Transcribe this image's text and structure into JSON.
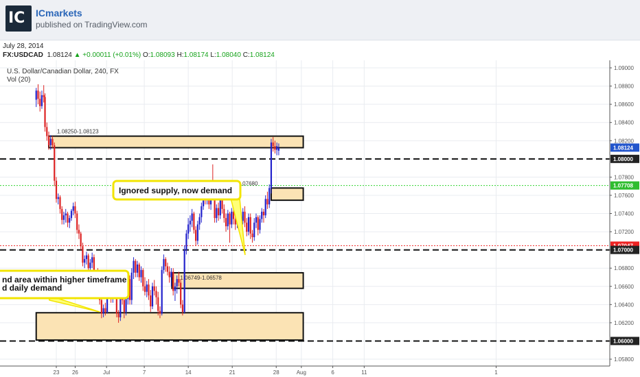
{
  "header": {
    "publisher": "ICmarkets",
    "subtitle": "published on TradingView.com",
    "logo_letters": "IC"
  },
  "date": "July 28, 2014",
  "quote": {
    "symbol": "FX:USDCAD",
    "last": "1.08124",
    "change": "+0.00011 (+0.01%)",
    "o_label": "O:",
    "o": "1.08093",
    "h_label": "H:",
    "h": "1.08174",
    "l_label": "L:",
    "l": "1.08040",
    "c_label": "C:",
    "c": "1.08124"
  },
  "chart_data": {
    "type": "candlestick",
    "title": "U.S. Dollar/Canadian Dollar, 240, FX",
    "indicator": "Vol (20)",
    "ylim": [
      1.0575,
      1.091
    ],
    "y_ticks": [
      "1.09000",
      "1.08800",
      "1.08600",
      "1.08400",
      "1.08200",
      "1.08000",
      "1.07800",
      "1.07600",
      "1.07400",
      "1.07200",
      "1.07000",
      "1.06800",
      "1.06600",
      "1.06400",
      "1.06200",
      "1.06000",
      "1.05800"
    ],
    "x_ticks": [
      {
        "label": "23",
        "day": 0
      },
      {
        "label": "26",
        "day": 3
      },
      {
        "label": "Jul",
        "day": 8
      },
      {
        "label": "7",
        "day": 14
      },
      {
        "label": "14",
        "day": 21
      },
      {
        "label": "21",
        "day": 28
      },
      {
        "label": "28",
        "day": 35
      },
      {
        "label": "Aug",
        "day": 39
      },
      {
        "label": "6",
        "day": 44
      },
      {
        "label": "11",
        "day": 49
      },
      {
        "label": "1",
        "day": 70
      }
    ],
    "colors": {
      "up": "#2222cc",
      "down": "#dd2222",
      "zone_fill": "#fbe3b4",
      "green_line": "#2fd22f",
      "red_line": "#ee2222"
    },
    "price_labels": [
      {
        "text": "1.08124",
        "price": 1.08124,
        "color": "#2255cc"
      },
      {
        "text": "1.08000",
        "price": 1.08,
        "color": "#222222"
      },
      {
        "text": "1.07708",
        "price": 1.07708,
        "color": "#2fbd2f"
      },
      {
        "text": "1.07047",
        "price": 1.07047,
        "color": "#ee2222"
      },
      {
        "text": "1.07000",
        "price": 1.07,
        "color": "#222222"
      },
      {
        "text": "1.06000",
        "price": 1.06,
        "color": "#222222"
      }
    ],
    "dashed_levels": [
      {
        "price": 1.08,
        "color": "#111111"
      },
      {
        "price": 1.07,
        "color": "#111111"
      },
      {
        "price": 1.06,
        "color": "#111111"
      }
    ],
    "dotted_levels": [
      {
        "price": 1.07708,
        "color": "#2fd22f"
      },
      {
        "price": 1.07047,
        "color": "#ee2222"
      }
    ],
    "zones": [
      {
        "label": "1.08250-1.08123",
        "top": 1.0825,
        "bottom": 1.08123,
        "d0": -1.2,
        "d1": 39.3
      },
      {
        "label": "1.07546-1.07680",
        "top": 1.0768,
        "bottom": 1.07546,
        "d0": 34.2,
        "d1": 39.3
      },
      {
        "label": "1.06749-1.06578",
        "top": 1.06749,
        "bottom": 1.06578,
        "d0": 18.4,
        "d1": 39.3
      },
      {
        "label": "",
        "top": 1.0631,
        "bottom": 1.0601,
        "d0": -3.2,
        "d1": 39.3
      }
    ],
    "annotations": [
      {
        "text": "Ignored supply, now demand"
      },
      {
        "text": "nd area within higher timeframe"
      },
      {
        "text": "d daily demand"
      }
    ],
    "candles": [
      [
        -3.2,
        1.0865,
        1.0878,
        1.0857,
        1.0875
      ],
      [
        -2.9,
        1.0875,
        1.0882,
        1.086,
        1.0866
      ],
      [
        -2.6,
        1.0866,
        1.0874,
        1.0852,
        1.0858
      ],
      [
        -2.3,
        1.0858,
        1.0875,
        1.0855,
        1.087
      ],
      [
        -2.0,
        1.087,
        1.0881,
        1.0862,
        1.0868
      ],
      [
        -1.8,
        1.0868,
        1.0872,
        1.083,
        1.0835
      ],
      [
        -1.5,
        1.0835,
        1.084,
        1.082,
        1.0825
      ],
      [
        -1.2,
        1.0825,
        1.083,
        1.081,
        1.0815
      ],
      [
        -0.9,
        1.0815,
        1.0826,
        1.081,
        1.0822
      ],
      [
        -0.6,
        1.0822,
        1.0825,
        1.0812,
        1.0815
      ],
      [
        -0.3,
        1.0815,
        1.0818,
        1.077,
        1.0776
      ],
      [
        0.0,
        1.0776,
        1.078,
        1.0752,
        1.0756
      ],
      [
        0.3,
        1.0756,
        1.0762,
        1.075,
        1.0758
      ],
      [
        0.6,
        1.0758,
        1.076,
        1.074,
        1.0745
      ],
      [
        0.9,
        1.0745,
        1.0748,
        1.0728,
        1.0733
      ],
      [
        1.2,
        1.0733,
        1.0742,
        1.0728,
        1.0738
      ],
      [
        1.5,
        1.0738,
        1.0745,
        1.073,
        1.074
      ],
      [
        1.8,
        1.074,
        1.0742,
        1.0725,
        1.073
      ],
      [
        2.1,
        1.073,
        1.0738,
        1.0724,
        1.0735
      ],
      [
        2.4,
        1.0735,
        1.0745,
        1.0732,
        1.0743
      ],
      [
        2.7,
        1.0743,
        1.0752,
        1.0738,
        1.0748
      ],
      [
        3.0,
        1.0748,
        1.0753,
        1.0735,
        1.074
      ],
      [
        3.3,
        1.074,
        1.0743,
        1.0718,
        1.0722
      ],
      [
        3.6,
        1.0722,
        1.0728,
        1.0712,
        1.0718
      ],
      [
        3.9,
        1.0718,
        1.072,
        1.07,
        1.0704
      ],
      [
        4.2,
        1.0704,
        1.0708,
        1.0682,
        1.0686
      ],
      [
        4.5,
        1.0686,
        1.0694,
        1.068,
        1.069
      ],
      [
        4.8,
        1.069,
        1.0698,
        1.0684,
        1.0694
      ],
      [
        5.1,
        1.0694,
        1.0696,
        1.0676,
        1.068
      ],
      [
        5.4,
        1.068,
        1.069,
        1.0675,
        1.0686
      ],
      [
        5.7,
        1.0686,
        1.0697,
        1.068,
        1.0692
      ],
      [
        6.0,
        1.0692,
        1.0695,
        1.0665,
        1.0668
      ],
      [
        6.3,
        1.0668,
        1.0678,
        1.066,
        1.0674
      ],
      [
        6.6,
        1.0674,
        1.068,
        1.0662,
        1.0666
      ],
      [
        6.9,
        1.0666,
        1.0672,
        1.064,
        1.0645
      ],
      [
        7.2,
        1.0645,
        1.0652,
        1.0625,
        1.063
      ],
      [
        7.5,
        1.063,
        1.064,
        1.0626,
        1.0636
      ],
      [
        7.8,
        1.0636,
        1.0642,
        1.0628,
        1.0632
      ],
      [
        8.1,
        1.0632,
        1.066,
        1.063,
        1.0656
      ],
      [
        8.4,
        1.0656,
        1.0668,
        1.065,
        1.0662
      ],
      [
        8.7,
        1.0662,
        1.0666,
        1.0642,
        1.0646
      ],
      [
        9.0,
        1.0646,
        1.0676,
        1.0642,
        1.0672
      ],
      [
        9.3,
        1.0672,
        1.0678,
        1.065,
        1.0655
      ],
      [
        9.6,
        1.0655,
        1.066,
        1.0626,
        1.063
      ],
      [
        9.9,
        1.063,
        1.0634,
        1.062,
        1.0626
      ],
      [
        10.2,
        1.0626,
        1.0652,
        1.0622,
        1.0648
      ],
      [
        10.5,
        1.0648,
        1.066,
        1.064,
        1.0645
      ],
      [
        10.8,
        1.0645,
        1.065,
        1.0625,
        1.0632
      ],
      [
        11.1,
        1.0632,
        1.065,
        1.0628,
        1.0646
      ],
      [
        11.4,
        1.0646,
        1.0672,
        1.064,
        1.0668
      ],
      [
        11.7,
        1.0668,
        1.0672,
        1.064,
        1.0645
      ],
      [
        12.0,
        1.0645,
        1.068,
        1.064,
        1.0675
      ],
      [
        12.3,
        1.0675,
        1.0692,
        1.0668,
        1.0688
      ],
      [
        12.6,
        1.0688,
        1.069,
        1.067,
        1.0675
      ],
      [
        12.9,
        1.0675,
        1.0688,
        1.067,
        1.0684
      ],
      [
        13.2,
        1.0684,
        1.0686,
        1.0666,
        1.067
      ],
      [
        13.5,
        1.067,
        1.0682,
        1.0664,
        1.0678
      ],
      [
        13.8,
        1.0678,
        1.068,
        1.0655,
        1.066
      ],
      [
        14.1,
        1.066,
        1.067,
        1.065,
        1.0654
      ],
      [
        14.4,
        1.0654,
        1.0666,
        1.0648,
        1.0662
      ],
      [
        14.7,
        1.0662,
        1.0668,
        1.0645,
        1.065
      ],
      [
        15.0,
        1.065,
        1.0656,
        1.0632,
        1.0638
      ],
      [
        15.3,
        1.0638,
        1.0664,
        1.0635,
        1.066
      ],
      [
        15.6,
        1.066,
        1.0667,
        1.065,
        1.0655
      ],
      [
        15.9,
        1.0655,
        1.066,
        1.064,
        1.0648
      ],
      [
        16.2,
        1.0648,
        1.0654,
        1.0628,
        1.0633
      ],
      [
        16.5,
        1.0633,
        1.0638,
        1.0625,
        1.063
      ],
      [
        16.8,
        1.063,
        1.0682,
        1.0628,
        1.0678
      ],
      [
        17.1,
        1.0678,
        1.0695,
        1.0674,
        1.069
      ],
      [
        17.4,
        1.069,
        1.0692,
        1.0676,
        1.0682
      ],
      [
        17.7,
        1.0682,
        1.0686,
        1.0672,
        1.0676
      ],
      [
        18.0,
        1.0676,
        1.0682,
        1.0664,
        1.067
      ],
      [
        18.3,
        1.067,
        1.068,
        1.066,
        1.0676
      ],
      [
        18.6,
        1.0676,
        1.068,
        1.065,
        1.0655
      ],
      [
        18.9,
        1.0655,
        1.0664,
        1.0644,
        1.066
      ],
      [
        19.2,
        1.066,
        1.0672,
        1.0652,
        1.0668
      ],
      [
        19.5,
        1.0668,
        1.0676,
        1.066,
        1.0664
      ],
      [
        19.8,
        1.0664,
        1.0668,
        1.0636,
        1.064
      ],
      [
        20.1,
        1.064,
        1.0645,
        1.0628,
        1.0632
      ],
      [
        20.4,
        1.0632,
        1.0705,
        1.063,
        1.07
      ],
      [
        20.7,
        1.07,
        1.0722,
        1.0695,
        1.0718
      ],
      [
        21.0,
        1.0718,
        1.0735,
        1.0712,
        1.0728
      ],
      [
        21.3,
        1.0728,
        1.0738,
        1.072,
        1.0732
      ],
      [
        21.6,
        1.0732,
        1.0745,
        1.0725,
        1.074
      ],
      [
        21.9,
        1.074,
        1.0742,
        1.0718,
        1.0722
      ],
      [
        22.2,
        1.0722,
        1.0726,
        1.0705,
        1.071
      ],
      [
        22.5,
        1.071,
        1.0732,
        1.0706,
        1.0728
      ],
      [
        22.8,
        1.0728,
        1.074,
        1.0722,
        1.0736
      ],
      [
        23.1,
        1.0736,
        1.0752,
        1.073,
        1.0748
      ],
      [
        23.4,
        1.0748,
        1.0768,
        1.0744,
        1.0762
      ],
      [
        23.7,
        1.0762,
        1.0772,
        1.075,
        1.0755
      ],
      [
        24.0,
        1.0755,
        1.0776,
        1.075,
        1.077
      ],
      [
        24.3,
        1.077,
        1.0772,
        1.0745,
        1.075
      ],
      [
        24.6,
        1.075,
        1.0766,
        1.0744,
        1.0762
      ],
      [
        24.9,
        1.0762,
        1.0794,
        1.0755,
        1.0758
      ],
      [
        25.2,
        1.0758,
        1.0762,
        1.073,
        1.0735
      ],
      [
        25.5,
        1.0735,
        1.075,
        1.073,
        1.0746
      ],
      [
        25.8,
        1.0746,
        1.0752,
        1.0732,
        1.0738
      ],
      [
        26.1,
        1.0738,
        1.0764,
        1.0734,
        1.076
      ],
      [
        26.4,
        1.076,
        1.0764,
        1.074,
        1.0745
      ],
      [
        26.7,
        1.0745,
        1.075,
        1.073,
        1.0735
      ],
      [
        27.0,
        1.0735,
        1.074,
        1.072,
        1.0726
      ],
      [
        27.3,
        1.0726,
        1.0744,
        1.0722,
        1.074
      ],
      [
        27.6,
        1.074,
        1.0742,
        1.0708,
        1.0728
      ],
      [
        27.9,
        1.0728,
        1.0746,
        1.0724,
        1.0742
      ],
      [
        28.2,
        1.0742,
        1.0748,
        1.0728,
        1.0734
      ],
      [
        28.5,
        1.0734,
        1.074,
        1.0722,
        1.0728
      ],
      [
        28.8,
        1.0728,
        1.0744,
        1.0724,
        1.074
      ],
      [
        29.1,
        1.074,
        1.0745,
        1.073,
        1.0736
      ],
      [
        29.4,
        1.0736,
        1.0742,
        1.0726,
        1.0732
      ],
      [
        29.7,
        1.0732,
        1.0746,
        1.0728,
        1.0742
      ],
      [
        30.0,
        1.0742,
        1.0748,
        1.0725,
        1.073
      ],
      [
        30.3,
        1.073,
        1.0735,
        1.0715,
        1.072
      ],
      [
        30.6,
        1.072,
        1.074,
        1.0716,
        1.0736
      ],
      [
        30.9,
        1.0736,
        1.074,
        1.0712,
        1.0718
      ],
      [
        31.2,
        1.0718,
        1.0722,
        1.0708,
        1.0714
      ],
      [
        31.5,
        1.0714,
        1.0735,
        1.071,
        1.073
      ],
      [
        31.8,
        1.073,
        1.074,
        1.0724,
        1.0736
      ],
      [
        32.1,
        1.0736,
        1.0738,
        1.0716,
        1.0722
      ],
      [
        32.4,
        1.0722,
        1.0738,
        1.0718,
        1.0734
      ],
      [
        32.7,
        1.0734,
        1.0746,
        1.073,
        1.0742
      ],
      [
        33.0,
        1.0742,
        1.0745,
        1.073,
        1.0738
      ],
      [
        33.3,
        1.0738,
        1.076,
        1.0735,
        1.0756
      ],
      [
        33.6,
        1.0756,
        1.0764,
        1.0745,
        1.075
      ],
      [
        33.9,
        1.075,
        1.0772,
        1.0746,
        1.0768
      ],
      [
        34.2,
        1.0768,
        1.0822,
        1.0762,
        1.0818
      ],
      [
        34.5,
        1.0818,
        1.0824,
        1.0808,
        1.0814
      ],
      [
        34.8,
        1.0814,
        1.082,
        1.0806,
        1.081
      ],
      [
        35.1,
        1.081,
        1.0818,
        1.0804,
        1.0814
      ],
      [
        35.4,
        1.0809,
        1.0817,
        1.0804,
        1.0812
      ]
    ]
  }
}
